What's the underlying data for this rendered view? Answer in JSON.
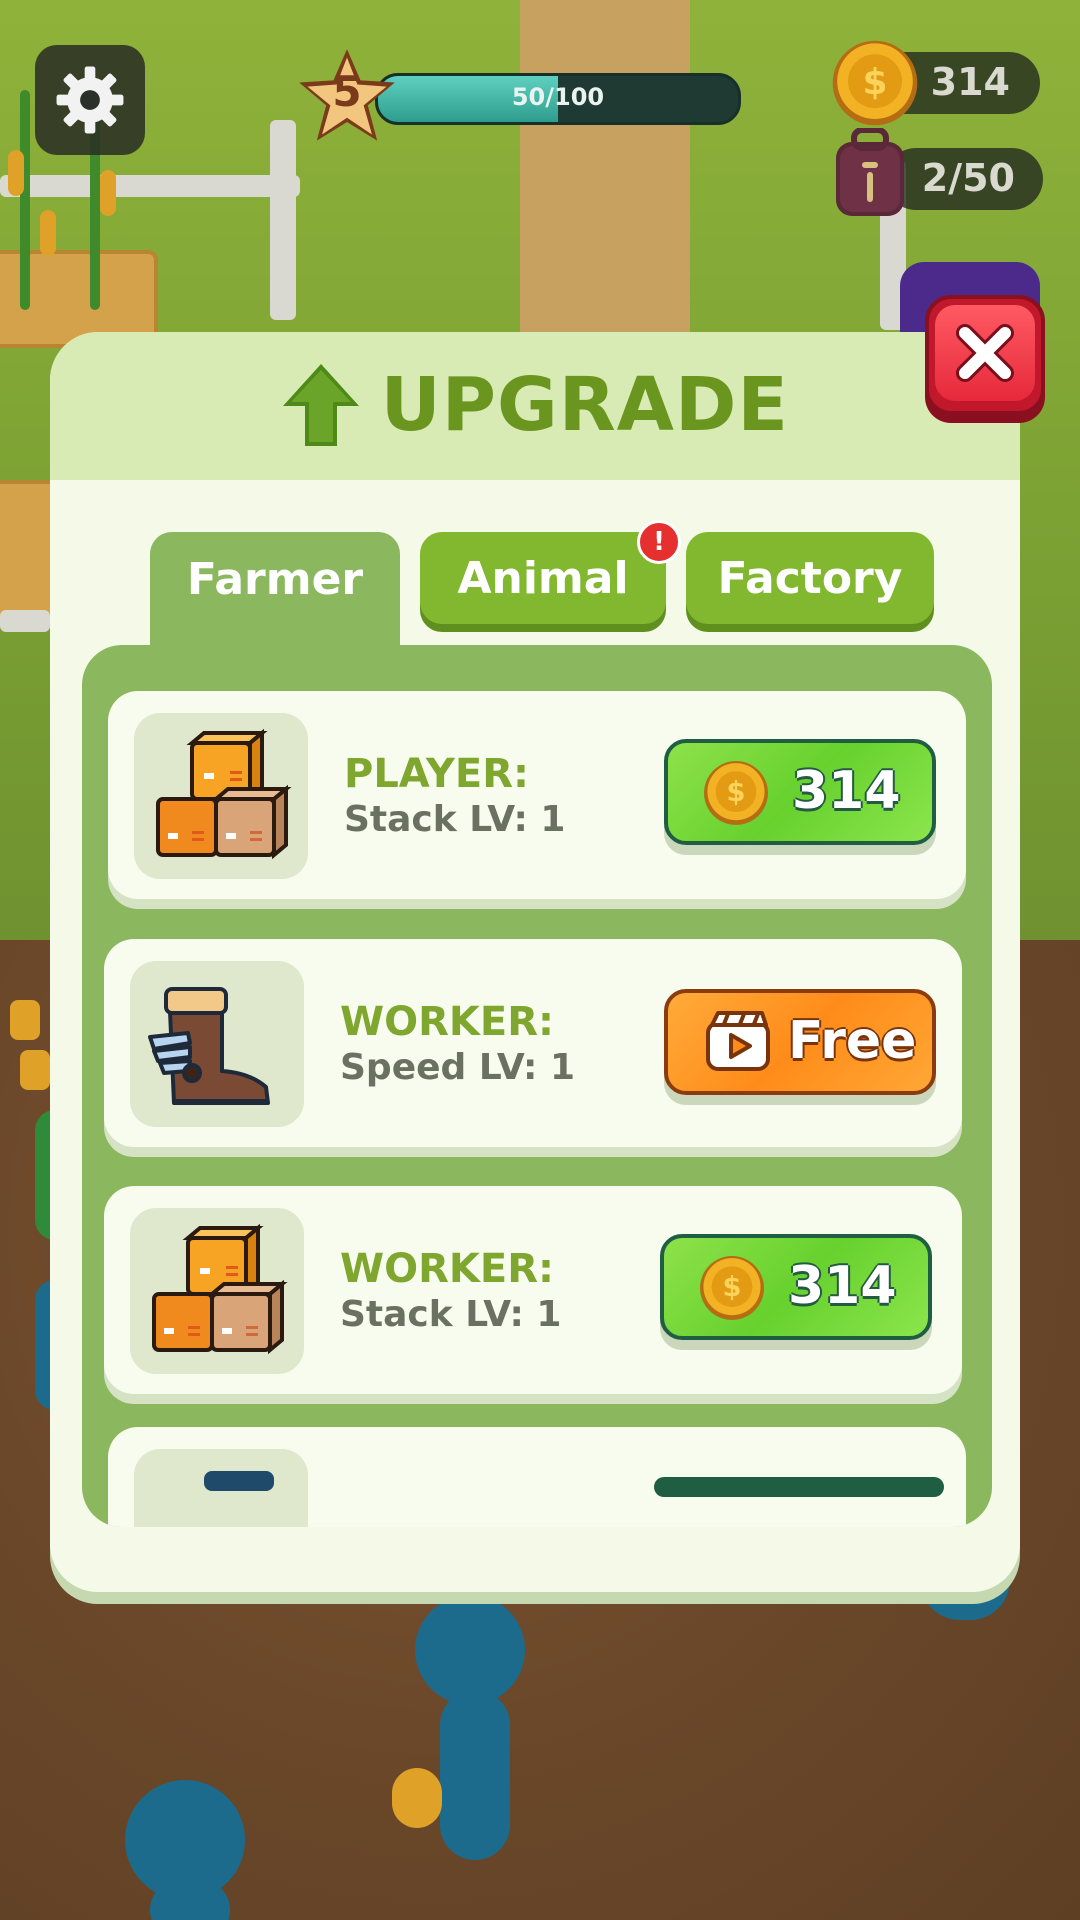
{
  "hud": {
    "level": "5",
    "xp_text": "50/100",
    "xp_progress": 0.5,
    "coins": "314",
    "bag": "2/50"
  },
  "modal": {
    "title": "UPGRADE",
    "tabs": [
      {
        "label": "Farmer",
        "active": true
      },
      {
        "label": "Animal",
        "active": false,
        "badge": "!"
      },
      {
        "label": "Factory",
        "active": false
      }
    ],
    "items": [
      {
        "title": "PLAYER:",
        "subtitle": "Stack LV: 1",
        "icon": "boxes-icon",
        "button": {
          "type": "coin",
          "label": "314"
        }
      },
      {
        "title": "WORKER:",
        "subtitle": "Speed LV: 1",
        "icon": "winged-boot-icon",
        "button": {
          "type": "video",
          "label": "Free"
        }
      },
      {
        "title": "WORKER:",
        "subtitle": "Stack LV: 1",
        "icon": "boxes-icon",
        "button": {
          "type": "coin",
          "label": "314"
        }
      }
    ]
  },
  "colors": {
    "accent_green": "#6a961f",
    "panel_green": "#8bb75e",
    "buy_green": "#67d12e",
    "buy_orange": "#ff8c1a",
    "close_red": "#e6293b"
  }
}
